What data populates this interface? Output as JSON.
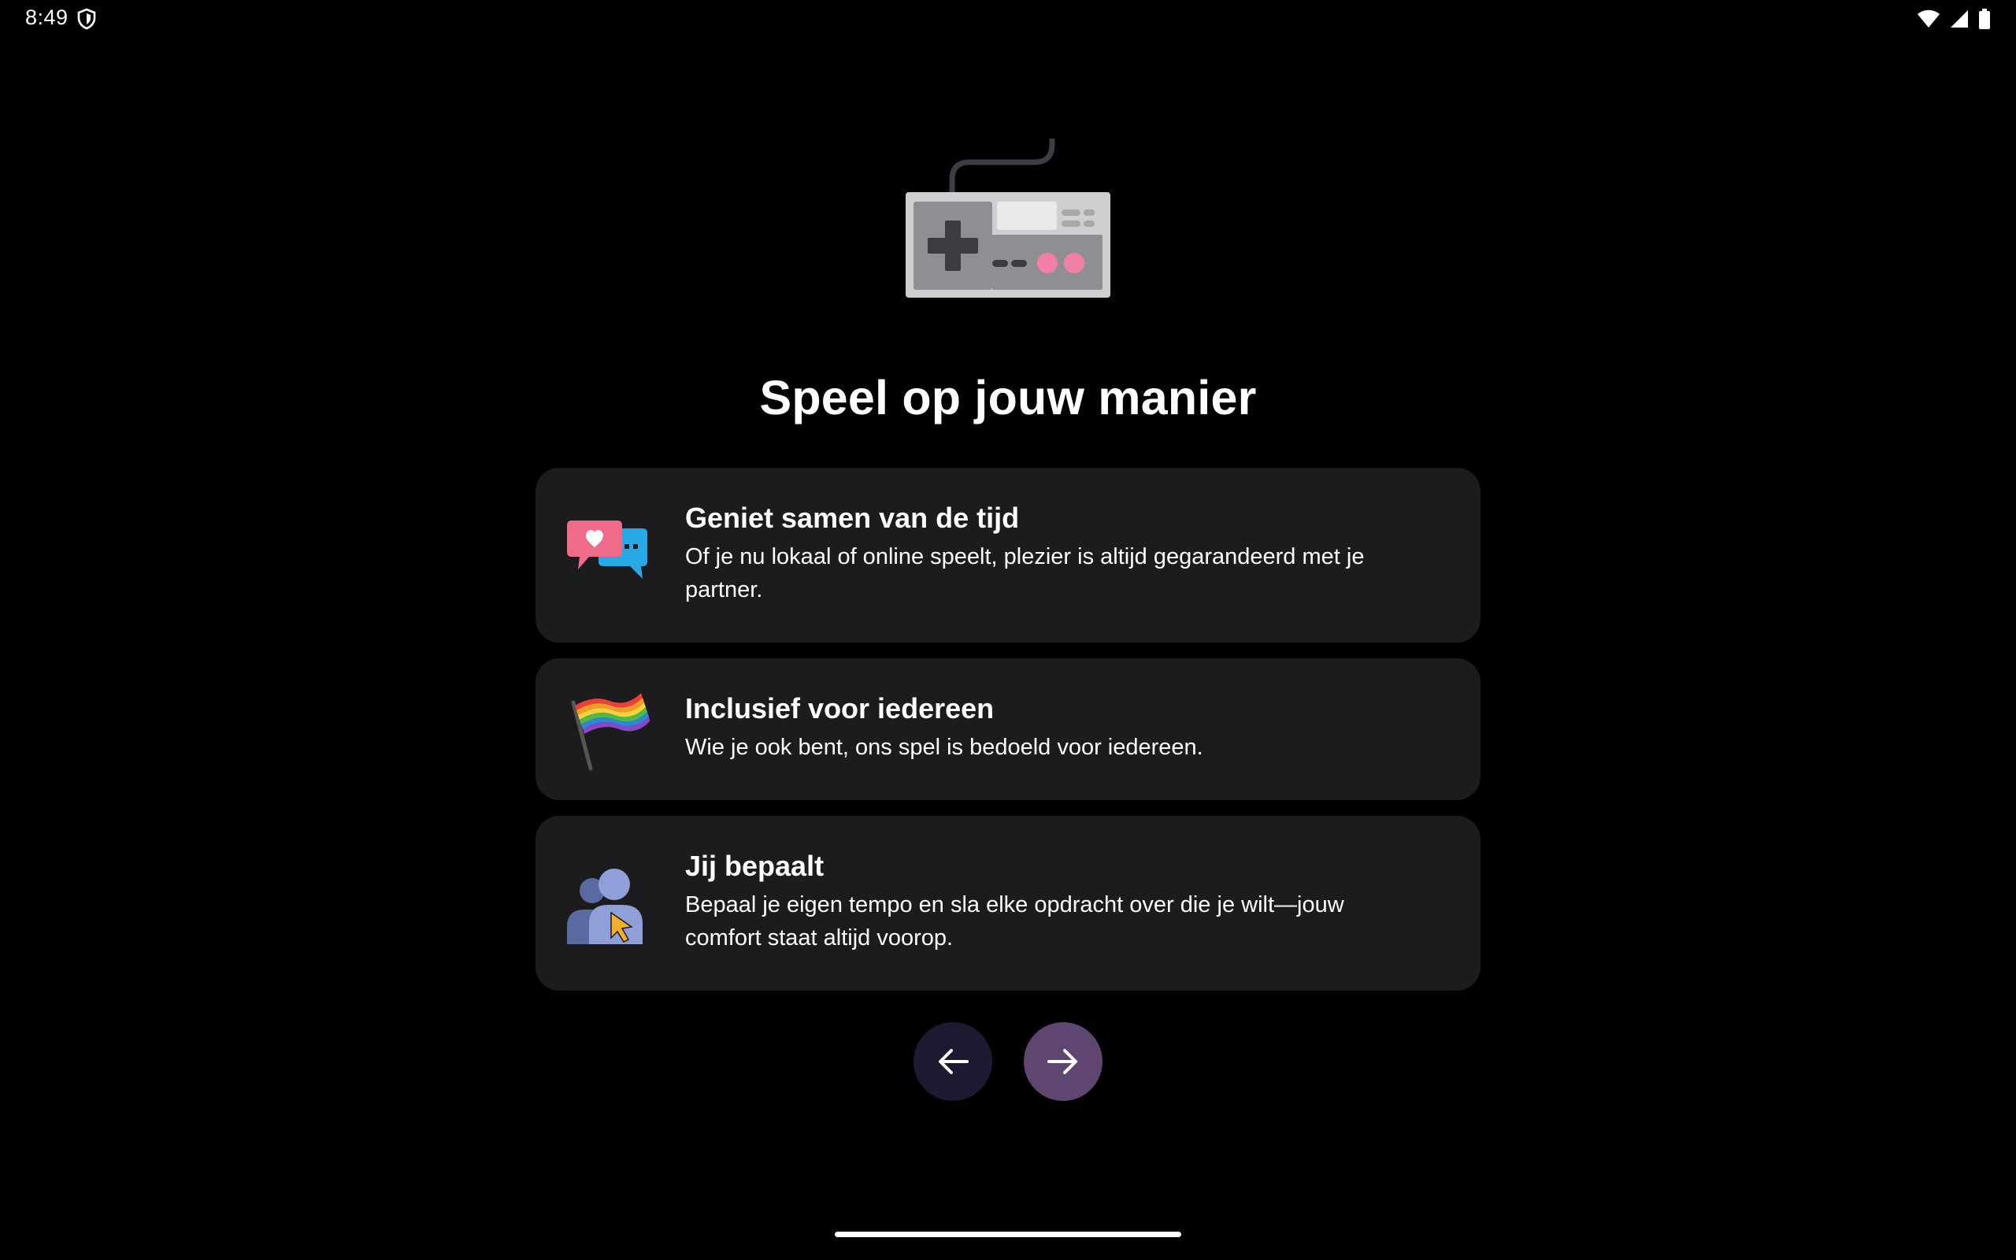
{
  "status_bar": {
    "time": "8:49",
    "icons": [
      "shield-icon",
      "wifi-icon",
      "signal-icon",
      "battery-icon"
    ]
  },
  "hero": {
    "icon": "game-controller-icon",
    "title": "Speel op jouw manier"
  },
  "features": [
    {
      "icon": "chat-bubbles-icon",
      "title": "Geniet samen van de tijd",
      "description": "Of je nu lokaal of online speelt, plezier is altijd gegarandeerd met je partner."
    },
    {
      "icon": "rainbow-flag-icon",
      "title": "Inclusief voor iedereen",
      "description": "Wie je ook bent, ons spel is bedoeld voor iedereen."
    },
    {
      "icon": "users-cursor-icon",
      "title": "Jij bepaalt",
      "description": "Bepaal je eigen tempo en sla elke opdracht over die je wilt—jouw comfort staat altijd voorop."
    }
  ],
  "navigation": {
    "back_icon": "arrow-left-icon",
    "next_icon": "arrow-right-icon"
  },
  "colors": {
    "background": "#000000",
    "card": "#1c1c1e",
    "back_button": "#1e1830",
    "next_button": "#5e4670",
    "accent_pink": "#f06a8a",
    "accent_blue": "#29a8e8"
  }
}
